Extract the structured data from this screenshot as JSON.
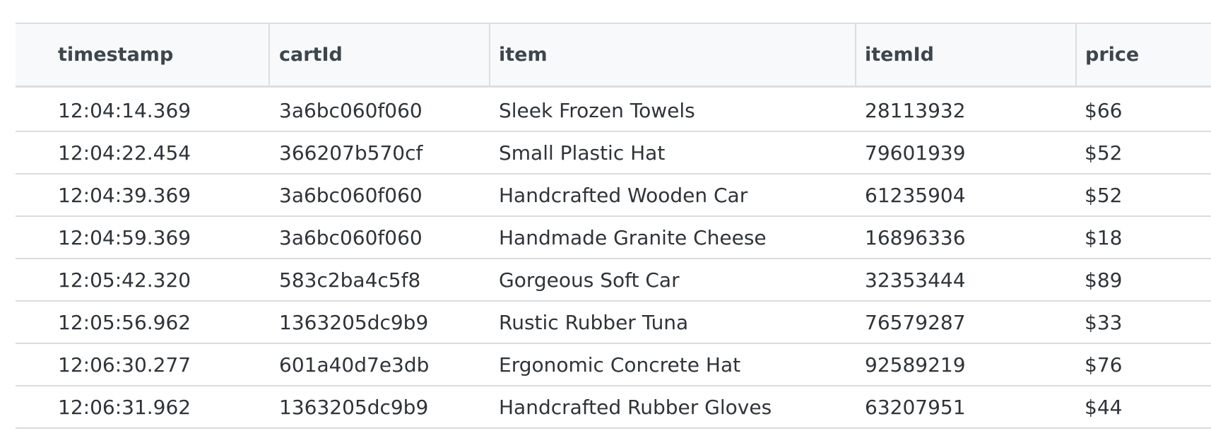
{
  "table": {
    "columns": [
      "timestamp",
      "cartId",
      "item",
      "itemId",
      "price"
    ],
    "rows": [
      [
        "12:04:14.369",
        "3a6bc060f060",
        "Sleek Frozen Towels",
        "28113932",
        "$66"
      ],
      [
        "12:04:22.454",
        "366207b570cf",
        "Small Plastic Hat",
        "79601939",
        "$52"
      ],
      [
        "12:04:39.369",
        "3a6bc060f060",
        "Handcrafted Wooden Car",
        "61235904",
        "$52"
      ],
      [
        "12:04:59.369",
        "3a6bc060f060",
        "Handmade Granite Cheese",
        "16896336",
        "$18"
      ],
      [
        "12:05:42.320",
        "583c2ba4c5f8",
        "Gorgeous Soft Car",
        "32353444",
        "$89"
      ],
      [
        "12:05:56.962",
        "1363205dc9b9",
        "Rustic Rubber Tuna",
        "76579287",
        "$33"
      ],
      [
        "12:06:30.277",
        "601a40d7e3db",
        "Ergonomic Concrete Hat",
        "92589219",
        "$76"
      ],
      [
        "12:06:31.962",
        "1363205dc9b9",
        "Handcrafted Rubber Gloves",
        "63207951",
        "$44"
      ]
    ]
  }
}
